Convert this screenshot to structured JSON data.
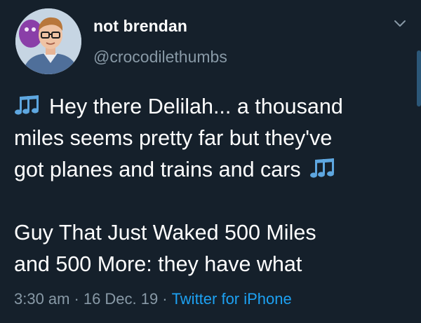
{
  "user": {
    "display_name": "not brendan",
    "handle": "@crocodilethumbs",
    "avatar_icon": "profile-photo-man-glasses"
  },
  "tweet": {
    "lines": [
      "Hey there Delilah... a thousand",
      "miles seems pretty far but they've",
      "got planes and trains and cars"
    ],
    "lines_2": [
      "Guy That Just Waked 500 Miles",
      "and 500 More: they have what"
    ],
    "emoji": "music-notes-icon"
  },
  "meta": {
    "time": "3:30 am",
    "date": "16 Dec. 19",
    "separator": "·",
    "source": "Twitter for iPhone"
  },
  "colors": {
    "background": "#15202b",
    "text": "#ffffff",
    "secondary": "#8899a6",
    "link": "#1da1f2",
    "emoji": "#5ea7e0"
  }
}
